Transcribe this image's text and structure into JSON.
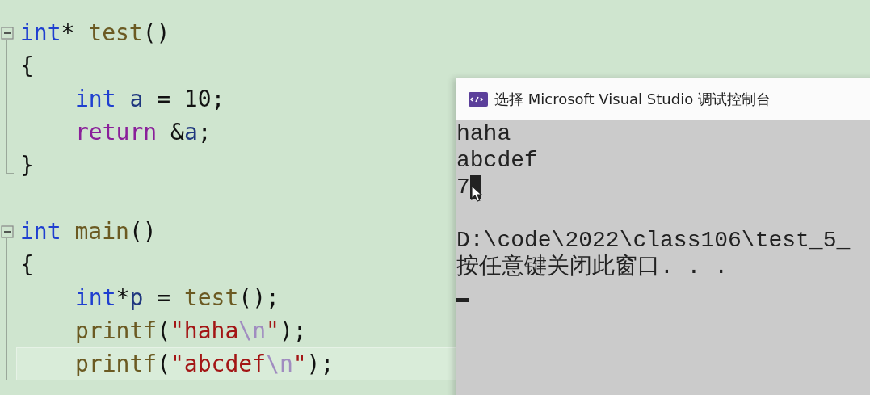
{
  "editor": {
    "functions": [
      {
        "lines": [
          {
            "indented": false,
            "current": false,
            "tokens": [
              {
                "text": "int",
                "kind": "keyword"
              },
              {
                "text": "* ",
                "kind": "plain"
              },
              {
                "text": "test",
                "kind": "func"
              },
              {
                "text": "()",
                "kind": "plain"
              }
            ]
          },
          {
            "indented": false,
            "current": false,
            "tokens": [
              {
                "text": "{",
                "kind": "plain"
              }
            ]
          },
          {
            "indented": true,
            "current": false,
            "tokens": [
              {
                "text": "int ",
                "kind": "keyword"
              },
              {
                "text": "a",
                "kind": "var"
              },
              {
                "text": " = 10;",
                "kind": "plain"
              }
            ]
          },
          {
            "indented": true,
            "current": false,
            "tokens": [
              {
                "text": "return",
                "kind": "control"
              },
              {
                "text": " &",
                "kind": "plain"
              },
              {
                "text": "a",
                "kind": "var"
              },
              {
                "text": ";",
                "kind": "plain"
              }
            ]
          },
          {
            "indented": false,
            "current": false,
            "tokens": [
              {
                "text": "}",
                "kind": "plain"
              }
            ]
          }
        ]
      },
      {
        "lines": [
          {
            "indented": false,
            "current": false,
            "tokens": [
              {
                "text": "int ",
                "kind": "keyword"
              },
              {
                "text": "main",
                "kind": "func"
              },
              {
                "text": "()",
                "kind": "plain"
              }
            ]
          },
          {
            "indented": false,
            "current": false,
            "tokens": [
              {
                "text": "{",
                "kind": "plain"
              }
            ]
          },
          {
            "indented": true,
            "current": false,
            "tokens": [
              {
                "text": "int",
                "kind": "keyword"
              },
              {
                "text": "*",
                "kind": "plain"
              },
              {
                "text": "p",
                "kind": "var"
              },
              {
                "text": " = ",
                "kind": "plain"
              },
              {
                "text": "test",
                "kind": "func"
              },
              {
                "text": "();",
                "kind": "plain"
              }
            ]
          },
          {
            "indented": true,
            "current": false,
            "tokens": [
              {
                "text": "printf",
                "kind": "func"
              },
              {
                "text": "(",
                "kind": "plain"
              },
              {
                "text": "\"haha",
                "kind": "string"
              },
              {
                "text": "\\n",
                "kind": "escape"
              },
              {
                "text": "\"",
                "kind": "string"
              },
              {
                "text": ");",
                "kind": "plain"
              }
            ]
          },
          {
            "indented": true,
            "current": true,
            "tokens": [
              {
                "text": "printf",
                "kind": "func"
              },
              {
                "text": "(",
                "kind": "plain"
              },
              {
                "text": "\"abcdef",
                "kind": "string"
              },
              {
                "text": "\\n",
                "kind": "escape"
              },
              {
                "text": "\"",
                "kind": "string"
              },
              {
                "text": ");",
                "kind": "plain"
              }
            ]
          }
        ]
      }
    ]
  },
  "console": {
    "title": "选择 Microsoft Visual Studio 调试控制台",
    "output": [
      "haha",
      "abcdef",
      "7"
    ],
    "exit_message": [
      "D:\\code\\2022\\class106\\test_5_",
      "按任意键关闭此窗口. . ."
    ]
  }
}
